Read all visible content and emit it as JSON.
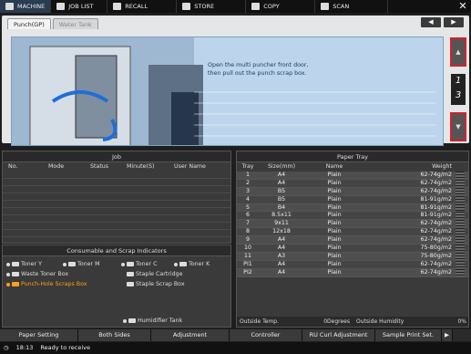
{
  "nav": {
    "tabs": [
      {
        "label": "MACHINE",
        "icon": "machine-icon"
      },
      {
        "label": "JOB LIST",
        "icon": "joblist-icon"
      },
      {
        "label": "RECALL",
        "icon": "recall-icon"
      },
      {
        "label": "STORE",
        "icon": "store-icon"
      },
      {
        "label": "COPY",
        "icon": "copy-icon"
      },
      {
        "label": "SCAN",
        "icon": "scan-icon"
      }
    ],
    "close": "✕"
  },
  "panel": {
    "tabs": [
      "Punch(GP)",
      "Water Tank"
    ],
    "prev": "◀",
    "next": "▶",
    "message1": "Open the multi puncher front door,",
    "message2": "then pull out the punch scrap box.",
    "up": "▲",
    "down": "▼",
    "page_current": "1",
    "page_total": "3"
  },
  "job": {
    "title": "Job",
    "cols": [
      "No.",
      "Mode",
      "Status",
      "Minute(S)",
      "User Name"
    ]
  },
  "consumables": {
    "title": "Consumable and Scrap Indicators",
    "items": [
      "Toner Y",
      "Toner M",
      "Toner C",
      "Toner K",
      "Waste Toner Box",
      "Staple Cartridge",
      "Punch-Hole Scraps Box",
      "Staple Scrap Box",
      "Humidifier Tank"
    ]
  },
  "tray": {
    "title": "Paper Tray",
    "cols": [
      "Tray",
      "Size(mm)",
      "Name",
      "Weight"
    ],
    "rows": [
      [
        "1",
        "A4",
        "Plain",
        "62-74g/m2"
      ],
      [
        "2",
        "A4",
        "Plain",
        "62-74g/m2"
      ],
      [
        "3",
        "B5",
        "Plain",
        "62-74g/m2"
      ],
      [
        "4",
        "B5",
        "Plain",
        "81-91g/m2"
      ],
      [
        "5",
        "B4",
        "Plain",
        "81-91g/m2"
      ],
      [
        "6",
        "8.5x11",
        "Plain",
        "81-91g/m2"
      ],
      [
        "7",
        "9x11",
        "Plain",
        "62-74g/m2"
      ],
      [
        "8",
        "12x18",
        "Plain",
        "62-74g/m2"
      ],
      [
        "9",
        "A4",
        "Plain",
        "62-74g/m2"
      ],
      [
        "10",
        "A4",
        "Plain",
        "75-80g/m2"
      ],
      [
        "11",
        "A3",
        "Plain",
        "75-80g/m2"
      ],
      [
        "PI1",
        "A4",
        "Plain",
        "62-74g/m2"
      ],
      [
        "PI2",
        "A4",
        "Plain",
        "62-74g/m2"
      ]
    ],
    "outside_temp_label": "Outside Temp.",
    "outside_temp": "0Degrees",
    "outside_humid_label": "Outside Humidity",
    "outside_humid": "0%"
  },
  "bottom": [
    "Paper Setting",
    "Both Sides",
    "Adjustment",
    "Controller",
    "RU Curl Adjustment",
    "Sample Print Set."
  ],
  "status": {
    "time": "18:13",
    "text": "Ready to receive"
  }
}
